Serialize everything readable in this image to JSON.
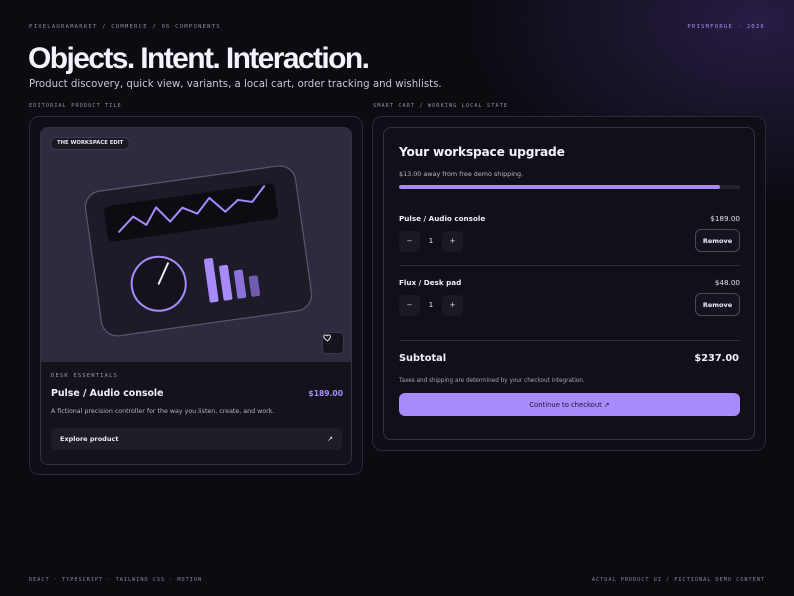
{
  "header": {
    "breadcrumb": "PIXELAURAMARKET / COMMERCE / 06 COMPONENTS",
    "brand": "PRISMFORGE · 2026",
    "title": "Objects. Intent. Interaction.",
    "subtitle": "Product discovery, quick view, variants, a local cart, order tracking and wishlists."
  },
  "sections": {
    "left_label": "EDITORIAL PRODUCT TILE",
    "right_label": "SMART CART / WORKING LOCAL STATE"
  },
  "product_tile": {
    "badge": "THE WORKSPACE EDIT",
    "eyebrow": "DESK ESSENTIALS",
    "name": "Pulse / Audio console",
    "price": "$189.00",
    "description": "A fictional precision controller for the way you listen, create, and work.",
    "cta_label": "Explore product",
    "cta_arrow": "↗",
    "wishlist_icon": "heart-icon",
    "illustration": {
      "meter_levels": [
        0.85,
        0.68,
        0.55,
        0.4
      ],
      "dial_value": 0.6
    }
  },
  "cart": {
    "title": "Your workspace upgrade",
    "shipping_note": "$13.00 away from free demo shipping.",
    "shipping_progress": 0.94,
    "items": [
      {
        "name": "Pulse / Audio console",
        "price": "$189.00",
        "quantity": "1",
        "minus": "−",
        "plus": "+",
        "remove_label": "Remove"
      },
      {
        "name": "Flux / Desk pad",
        "price": "$48.00",
        "quantity": "1",
        "minus": "−",
        "plus": "+",
        "remove_label": "Remove"
      }
    ],
    "subtotal_label": "Subtotal",
    "subtotal_value": "$237.00",
    "tax_note": "Taxes and shipping are determined by your checkout integration.",
    "checkout_label": "Continue to checkout ↗"
  },
  "footer": {
    "left": "REACT · TYPESCRIPT · TAILWIND CSS · MOTION",
    "right": "ACTUAL PRODUCT UI / FICTIONAL DEMO CONTENT"
  },
  "colors": {
    "accent": "#a78bfa",
    "background": "#0c0b12",
    "surface": "#14131c"
  }
}
